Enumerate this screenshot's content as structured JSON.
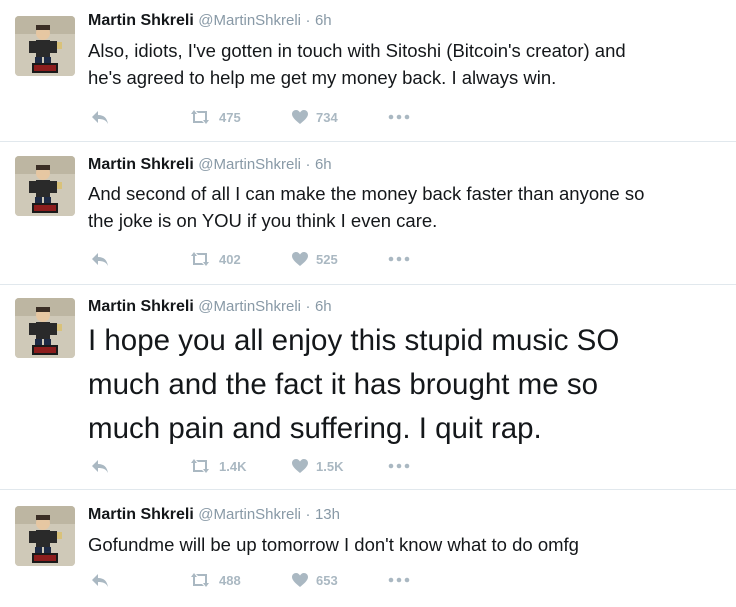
{
  "tweets": [
    {
      "name": "Martin Shkreli",
      "handle": "@MartinShkreli",
      "time": "6h",
      "text_lines": [
        "Also, idiots, I've gotten in touch with Sitoshi (Bitcoin's creator) and",
        "he's agreed to help me get my money back. I always win."
      ],
      "retweets": "475",
      "likes": "734"
    },
    {
      "name": "Martin Shkreli",
      "handle": "@MartinShkreli",
      "time": "6h",
      "text_lines": [
        "And second of all I can make the money back faster than anyone so",
        "the joke is on YOU if you think I even care."
      ],
      "retweets": "402",
      "likes": "525"
    },
    {
      "name": "Martin Shkreli",
      "handle": "@MartinShkreli",
      "time": "6h",
      "text_lines": [
        "I hope you all enjoy this stupid music SO",
        "much and the fact it has brought me so",
        "much pain and suffering. I quit rap."
      ],
      "retweets": "1.4K",
      "likes": "1.5K"
    },
    {
      "name": "Martin Shkreli",
      "handle": "@MartinShkreli",
      "time": "13h",
      "text_lines": [
        "Gofundme will be up tomorrow I don't know what to do omfg"
      ],
      "retweets": "488",
      "likes": "653"
    }
  ],
  "separator": "·",
  "icons": {
    "reply": "reply-icon",
    "retweet": "retweet-icon",
    "like": "heart-icon",
    "more": "more-icon",
    "avatar": "avatar"
  },
  "colors": {
    "text": "#14171a",
    "muted": "#8899a6",
    "action": "#aab8c2",
    "divider": "#e1e8ed"
  }
}
